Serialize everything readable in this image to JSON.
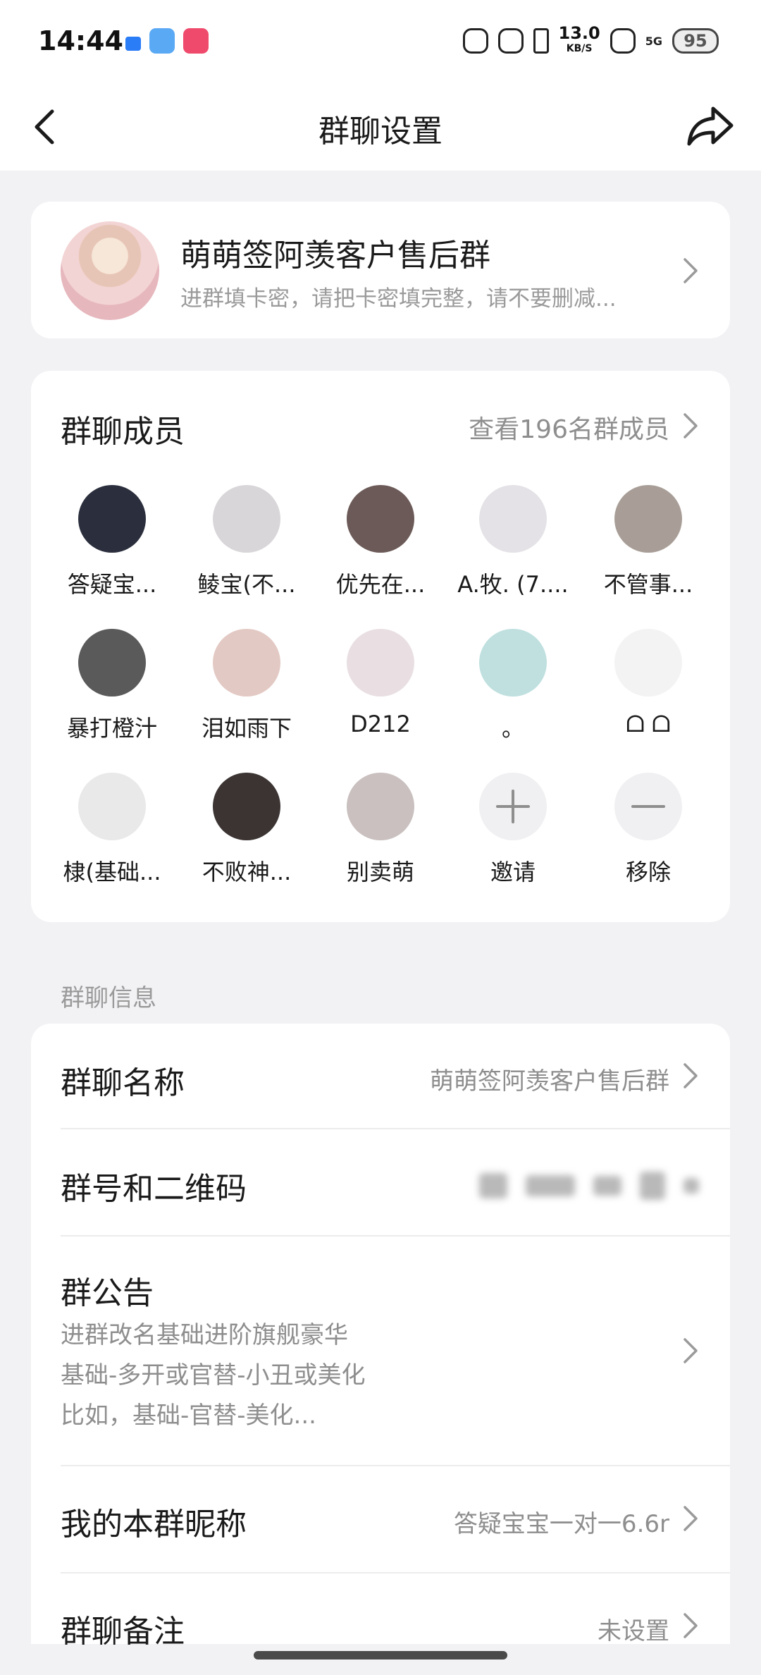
{
  "status_bar": {
    "time": "14:44",
    "net_speed": "13.0",
    "net_speed_unit": "KB/S",
    "network": "5G",
    "battery": "95"
  },
  "nav": {
    "title": "群聊设置",
    "back_icon": "chevron-left-icon",
    "share_icon": "share-icon"
  },
  "group": {
    "name": "萌萌签阿羡客户售后群",
    "description": "进群填卡密，请把卡密填完整，请不要删减..."
  },
  "members": {
    "title": "群聊成员",
    "view_all": "查看196名群成员",
    "list": [
      {
        "name": "答疑宝...",
        "color": "#2b2f3d"
      },
      {
        "name": "鲮宝(不...",
        "color": "#d9d6d9"
      },
      {
        "name": "优先在...",
        "color": "#6b5a57"
      },
      {
        "name": "A.牧. (7....",
        "color": "#e4e2e6"
      },
      {
        "name": "不管事...",
        "color": "#a89e97"
      },
      {
        "name": "暴打橙汁",
        "color": "#5a5a5a"
      },
      {
        "name": "泪如雨下",
        "color": "#e3c9c4"
      },
      {
        "name": "D212",
        "color": "#e9dfe3"
      },
      {
        "name": "。",
        "color": "#bfe0df"
      },
      {
        "name": "ᗝ ᗝ",
        "color": "#f3f3f3"
      },
      {
        "name": "棣(基础...",
        "color": "#e9e9e9"
      },
      {
        "name": "不败神...",
        "color": "#3b3433"
      },
      {
        "name": "别卖萌",
        "color": "#c9c0bf"
      }
    ],
    "invite_label": "邀请",
    "remove_label": "移除"
  },
  "info": {
    "section_label": "群聊信息",
    "group_name_label": "群聊名称",
    "group_name_value": "萌萌签阿羡客户售后群",
    "qr_label": "群号和二维码",
    "notice_label": "群公告",
    "notice_lines": [
      "进群改名基础进阶旗舰豪华",
      "基础-多开或官替-小丑或美化",
      "比如，基础-官替-美化..."
    ],
    "nickname_label": "我的本群昵称",
    "nickname_value": "答疑宝宝一对一6.6r",
    "remark_label": "群聊备注",
    "remark_value": "未设置"
  }
}
